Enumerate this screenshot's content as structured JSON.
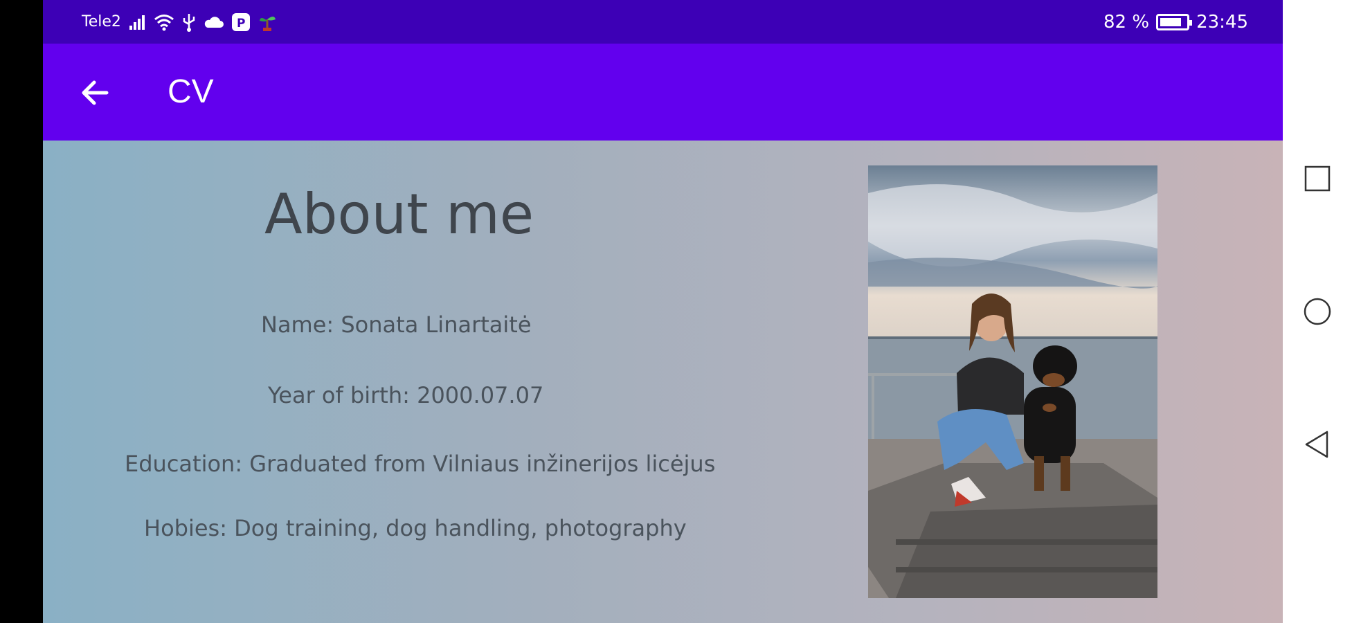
{
  "status_bar": {
    "carrier": "Tele2",
    "battery_percent": "82 %",
    "battery_level": 0.82,
    "time": "23:45",
    "icons": [
      "signal-icon",
      "wifi-icon",
      "usb-icon",
      "cloud-icon",
      "app-notification-icon",
      "plant-icon"
    ]
  },
  "app_bar": {
    "back_icon": "arrow-back-icon",
    "title": "CV"
  },
  "about": {
    "heading": "About me",
    "name": "Name: Sonata Linartaitė",
    "birth": "Year of birth: 2000.07.07",
    "education": "Education: Graduated from Vilniaus inžinerijos licėjus",
    "hobbies": "Hobies: Dog training, dog handling, photography"
  },
  "nav_bar": {
    "recents_icon": "square-icon",
    "home_icon": "circle-icon",
    "back_icon": "triangle-back-icon"
  }
}
